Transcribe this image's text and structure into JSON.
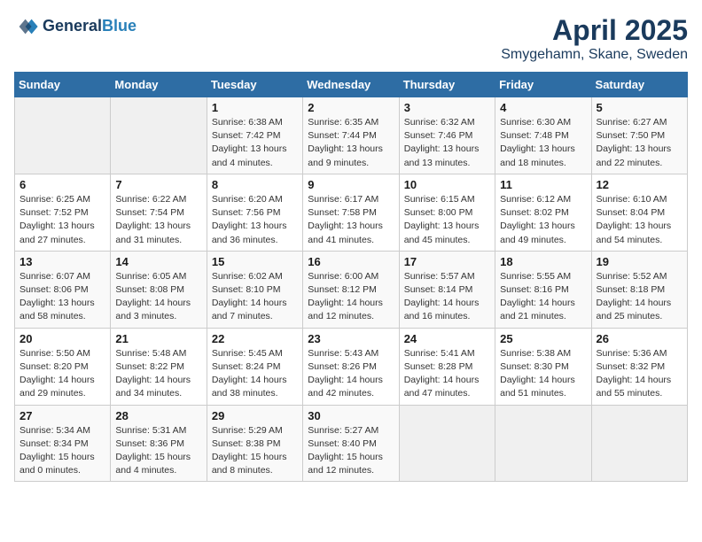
{
  "header": {
    "logo_line1": "General",
    "logo_line2": "Blue",
    "month": "April 2025",
    "location": "Smygehamn, Skane, Sweden"
  },
  "weekdays": [
    "Sunday",
    "Monday",
    "Tuesday",
    "Wednesday",
    "Thursday",
    "Friday",
    "Saturday"
  ],
  "weeks": [
    [
      {
        "day": "",
        "info": ""
      },
      {
        "day": "",
        "info": ""
      },
      {
        "day": "1",
        "info": "Sunrise: 6:38 AM\nSunset: 7:42 PM\nDaylight: 13 hours\nand 4 minutes."
      },
      {
        "day": "2",
        "info": "Sunrise: 6:35 AM\nSunset: 7:44 PM\nDaylight: 13 hours\nand 9 minutes."
      },
      {
        "day": "3",
        "info": "Sunrise: 6:32 AM\nSunset: 7:46 PM\nDaylight: 13 hours\nand 13 minutes."
      },
      {
        "day": "4",
        "info": "Sunrise: 6:30 AM\nSunset: 7:48 PM\nDaylight: 13 hours\nand 18 minutes."
      },
      {
        "day": "5",
        "info": "Sunrise: 6:27 AM\nSunset: 7:50 PM\nDaylight: 13 hours\nand 22 minutes."
      }
    ],
    [
      {
        "day": "6",
        "info": "Sunrise: 6:25 AM\nSunset: 7:52 PM\nDaylight: 13 hours\nand 27 minutes."
      },
      {
        "day": "7",
        "info": "Sunrise: 6:22 AM\nSunset: 7:54 PM\nDaylight: 13 hours\nand 31 minutes."
      },
      {
        "day": "8",
        "info": "Sunrise: 6:20 AM\nSunset: 7:56 PM\nDaylight: 13 hours\nand 36 minutes."
      },
      {
        "day": "9",
        "info": "Sunrise: 6:17 AM\nSunset: 7:58 PM\nDaylight: 13 hours\nand 41 minutes."
      },
      {
        "day": "10",
        "info": "Sunrise: 6:15 AM\nSunset: 8:00 PM\nDaylight: 13 hours\nand 45 minutes."
      },
      {
        "day": "11",
        "info": "Sunrise: 6:12 AM\nSunset: 8:02 PM\nDaylight: 13 hours\nand 49 minutes."
      },
      {
        "day": "12",
        "info": "Sunrise: 6:10 AM\nSunset: 8:04 PM\nDaylight: 13 hours\nand 54 minutes."
      }
    ],
    [
      {
        "day": "13",
        "info": "Sunrise: 6:07 AM\nSunset: 8:06 PM\nDaylight: 13 hours\nand 58 minutes."
      },
      {
        "day": "14",
        "info": "Sunrise: 6:05 AM\nSunset: 8:08 PM\nDaylight: 14 hours\nand 3 minutes."
      },
      {
        "day": "15",
        "info": "Sunrise: 6:02 AM\nSunset: 8:10 PM\nDaylight: 14 hours\nand 7 minutes."
      },
      {
        "day": "16",
        "info": "Sunrise: 6:00 AM\nSunset: 8:12 PM\nDaylight: 14 hours\nand 12 minutes."
      },
      {
        "day": "17",
        "info": "Sunrise: 5:57 AM\nSunset: 8:14 PM\nDaylight: 14 hours\nand 16 minutes."
      },
      {
        "day": "18",
        "info": "Sunrise: 5:55 AM\nSunset: 8:16 PM\nDaylight: 14 hours\nand 21 minutes."
      },
      {
        "day": "19",
        "info": "Sunrise: 5:52 AM\nSunset: 8:18 PM\nDaylight: 14 hours\nand 25 minutes."
      }
    ],
    [
      {
        "day": "20",
        "info": "Sunrise: 5:50 AM\nSunset: 8:20 PM\nDaylight: 14 hours\nand 29 minutes."
      },
      {
        "day": "21",
        "info": "Sunrise: 5:48 AM\nSunset: 8:22 PM\nDaylight: 14 hours\nand 34 minutes."
      },
      {
        "day": "22",
        "info": "Sunrise: 5:45 AM\nSunset: 8:24 PM\nDaylight: 14 hours\nand 38 minutes."
      },
      {
        "day": "23",
        "info": "Sunrise: 5:43 AM\nSunset: 8:26 PM\nDaylight: 14 hours\nand 42 minutes."
      },
      {
        "day": "24",
        "info": "Sunrise: 5:41 AM\nSunset: 8:28 PM\nDaylight: 14 hours\nand 47 minutes."
      },
      {
        "day": "25",
        "info": "Sunrise: 5:38 AM\nSunset: 8:30 PM\nDaylight: 14 hours\nand 51 minutes."
      },
      {
        "day": "26",
        "info": "Sunrise: 5:36 AM\nSunset: 8:32 PM\nDaylight: 14 hours\nand 55 minutes."
      }
    ],
    [
      {
        "day": "27",
        "info": "Sunrise: 5:34 AM\nSunset: 8:34 PM\nDaylight: 15 hours\nand 0 minutes."
      },
      {
        "day": "28",
        "info": "Sunrise: 5:31 AM\nSunset: 8:36 PM\nDaylight: 15 hours\nand 4 minutes."
      },
      {
        "day": "29",
        "info": "Sunrise: 5:29 AM\nSunset: 8:38 PM\nDaylight: 15 hours\nand 8 minutes."
      },
      {
        "day": "30",
        "info": "Sunrise: 5:27 AM\nSunset: 8:40 PM\nDaylight: 15 hours\nand 12 minutes."
      },
      {
        "day": "",
        "info": ""
      },
      {
        "day": "",
        "info": ""
      },
      {
        "day": "",
        "info": ""
      }
    ]
  ]
}
